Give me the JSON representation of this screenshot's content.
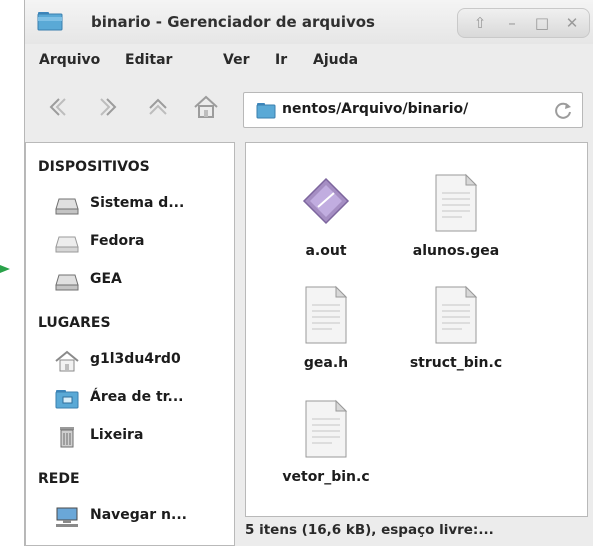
{
  "window": {
    "title": "binario - Gerenciador de arquivos"
  },
  "menu": {
    "items": [
      "Arquivo",
      "Editar",
      "Ver",
      "Ir",
      "Ajuda"
    ]
  },
  "address": {
    "path": "nentos/Arquivo/binario/"
  },
  "sidebar": {
    "sections": [
      {
        "title": "DISPOSITIVOS",
        "items": [
          "Sistema d...",
          "Fedora",
          "GEA"
        ]
      },
      {
        "title": "LUGARES",
        "items": [
          "g1l3du4rd0",
          "Área de tr...",
          "Lixeira"
        ]
      },
      {
        "title": "REDE",
        "items": [
          "Navegar n..."
        ]
      }
    ]
  },
  "files": [
    {
      "name": "a.out",
      "icon": "executable-icon"
    },
    {
      "name": "alunos.gea",
      "icon": "text-file-icon"
    },
    {
      "name": "gea.h",
      "icon": "text-file-icon"
    },
    {
      "name": "struct_bin.c",
      "icon": "text-file-icon"
    },
    {
      "name": "vetor_bin.c",
      "icon": "text-file-icon"
    }
  ],
  "status": {
    "text": "5 itens (16,6 kB), espaço livre:..."
  },
  "colors": {
    "folder": "#5aa9d6",
    "accent": "#2aa24a",
    "window_bg": "#ececec"
  }
}
